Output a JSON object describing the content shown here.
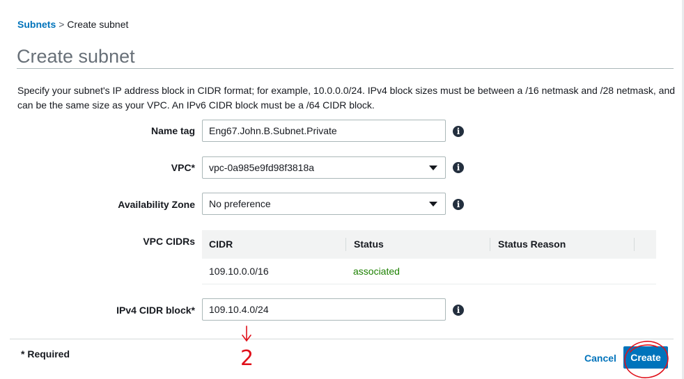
{
  "breadcrumb": {
    "parent": "Subnets",
    "separator": ">",
    "current": "Create subnet"
  },
  "page": {
    "title": "Create subnet",
    "intro": "Specify your subnet's IP address block in CIDR format; for example, 10.0.0.0/24. IPv4 block sizes must be between a /16 netmask and /28 netmask, and can be the same size as your VPC. An IPv6 CIDR block must be a /64 CIDR block."
  },
  "form": {
    "name_tag": {
      "label": "Name tag",
      "value": "Eng67.John.B.Subnet.Private"
    },
    "vpc": {
      "label": "VPC*",
      "value": "vpc-0a985e9fd98f3818a"
    },
    "az": {
      "label": "Availability Zone",
      "value": "No preference"
    },
    "vpc_cidrs": {
      "label": "VPC CIDRs",
      "columns": [
        "CIDR",
        "Status",
        "Status Reason"
      ],
      "rows": [
        {
          "cidr": "109.10.0.0/16",
          "status": "associated",
          "reason": ""
        }
      ]
    },
    "ipv4": {
      "label": "IPv4 CIDR block*",
      "value": "109.10.4.0/24"
    },
    "info_glyph": "i"
  },
  "footer": {
    "required": "* Required",
    "cancel": "Cancel",
    "create": "Create"
  },
  "annotation": {
    "text": "2",
    "color": "#e0101a"
  },
  "icons": {
    "info": "info-circle-icon",
    "dropdown": "caret-down-icon"
  }
}
